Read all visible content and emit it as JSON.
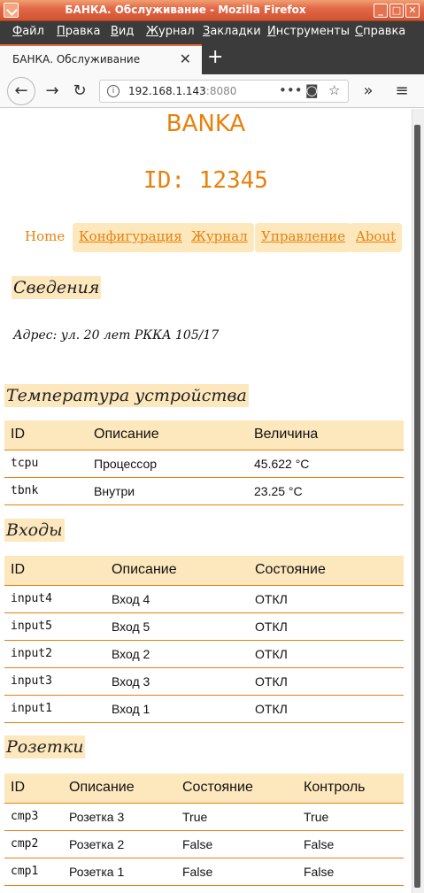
{
  "window": {
    "title": "БАНКА. Обслуживание - Mozilla Firefox"
  },
  "menu": [
    "Файл",
    "Правка",
    "Вид",
    "Журнал",
    "Закладки",
    "Инструменты",
    "Справка"
  ],
  "tab": {
    "label": "БАНКА. Обслуживание",
    "close": "✕",
    "new": "+"
  },
  "navbar": {
    "url_host": "192.168.1.143",
    "url_port": ":8080"
  },
  "page": {
    "brand": "BANKA",
    "device_id": "ID: 12345",
    "nav": [
      "Home",
      "Конфигурация",
      "Журнал",
      "Управление",
      "About"
    ],
    "info_heading": "Сведения",
    "address": "Адрес: ул. 20 лет РККА 105/17",
    "temp_heading": "Температура устройства",
    "temp_headers": [
      "ID",
      "Описание",
      "Величина"
    ],
    "temp_rows": [
      [
        "tcpu",
        "Процессор",
        "45.622 °C"
      ],
      [
        "tbnk",
        "Внутри",
        "23.25 °C"
      ]
    ],
    "inputs_heading": "Входы",
    "inputs_headers": [
      "ID",
      "Описание",
      "Состояние"
    ],
    "inputs_rows": [
      [
        "input4",
        "Вход 4",
        "ОТКЛ"
      ],
      [
        "input5",
        "Вход 5",
        "ОТКЛ"
      ],
      [
        "input2",
        "Вход 2",
        "ОТКЛ"
      ],
      [
        "input3",
        "Вход 3",
        "ОТКЛ"
      ],
      [
        "input1",
        "Вход 1",
        "ОТКЛ"
      ]
    ],
    "sockets_heading": "Розетки",
    "sockets_headers": [
      "ID",
      "Описание",
      "Состояние",
      "Контроль"
    ],
    "sockets_rows": [
      [
        "cmp3",
        "Розетка 3",
        "True",
        "True"
      ],
      [
        "cmp2",
        "Розетка 2",
        "False",
        "False"
      ],
      [
        "cmp1",
        "Розетка 1",
        "False",
        "False"
      ]
    ]
  }
}
